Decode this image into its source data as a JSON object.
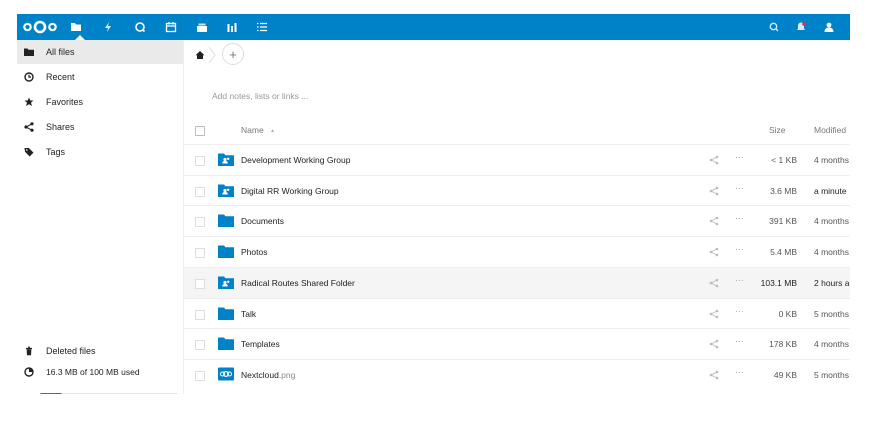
{
  "header": {
    "apps": [
      "nextcloud-logo-icon",
      "files-icon",
      "activity-icon",
      "search-app-icon",
      "calendar-icon",
      "deck-icon",
      "analytics-icon",
      "tasks-icon"
    ],
    "right": [
      "search-icon",
      "notifications-icon",
      "contacts-icon"
    ]
  },
  "sidebar": {
    "items": [
      {
        "label": "All files",
        "icon": "folder-icon"
      },
      {
        "label": "Recent",
        "icon": "clock-icon"
      },
      {
        "label": "Favorites",
        "icon": "star-icon"
      },
      {
        "label": "Shares",
        "icon": "share-icon"
      },
      {
        "label": "Tags",
        "icon": "tag-icon"
      }
    ],
    "collapse_glyph": ")",
    "deleted_label": "Deleted files",
    "quota_label": "16.3 MB of 100 MB used",
    "quota_fraction": 0.163
  },
  "main": {
    "notes_placeholder": "Add notes, lists or links ...",
    "add_symbol": "+",
    "columns": {
      "name": "Name",
      "sort_indicator": "▲",
      "size": "Size",
      "modified": "Modified"
    },
    "files": [
      {
        "name": "Development Working Group",
        "ext": "",
        "type": "shared-folder",
        "size": "< 1 KB",
        "modified": "4 months"
      },
      {
        "name": "Digital RR Working Group",
        "ext": "",
        "type": "shared-folder",
        "size": "3.6 MB",
        "modified": "a minute"
      },
      {
        "name": "Documents",
        "ext": "",
        "type": "folder",
        "size": "391 KB",
        "modified": "4 months"
      },
      {
        "name": "Photos",
        "ext": "",
        "type": "folder",
        "size": "5.4 MB",
        "modified": "4 months"
      },
      {
        "name": "Radical Routes Shared Folder",
        "ext": "",
        "type": "shared-folder",
        "size": "103.1 MB",
        "modified": "2 hours a"
      },
      {
        "name": "Talk",
        "ext": "",
        "type": "folder",
        "size": "0 KB",
        "modified": "5 months"
      },
      {
        "name": "Templates",
        "ext": "",
        "type": "folder",
        "size": "178 KB",
        "modified": "4 months"
      },
      {
        "name": "Nextcloud",
        "ext": ".png",
        "type": "image",
        "size": "49 KB",
        "modified": "5 months"
      }
    ]
  },
  "colors": {
    "brand": "#0082c9",
    "folder": "#0082c9"
  }
}
